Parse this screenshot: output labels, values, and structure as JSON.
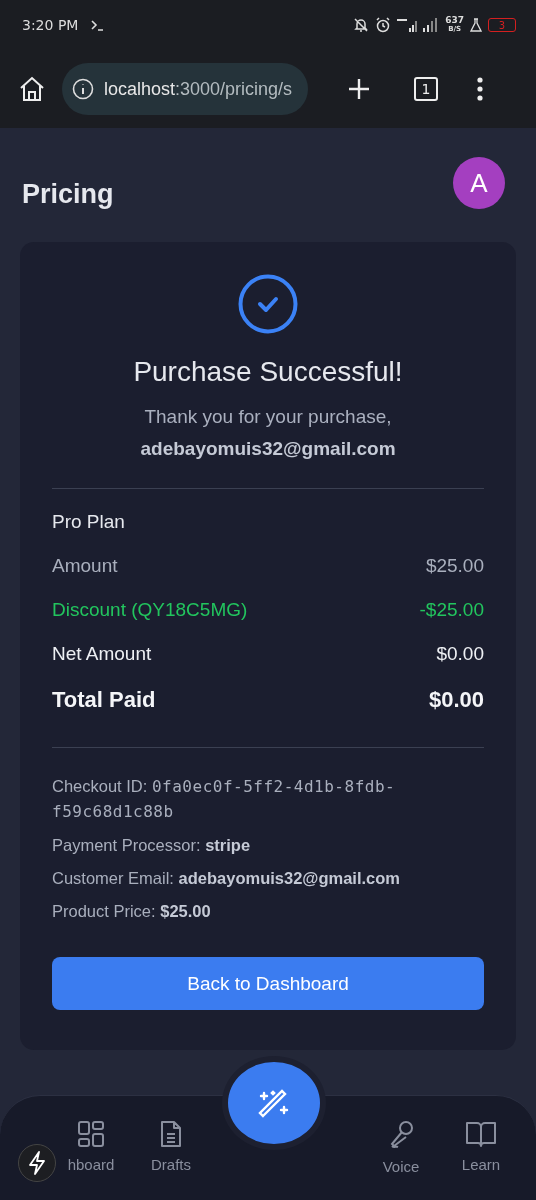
{
  "status_bar": {
    "time": "3:20 PM",
    "net_speed": "637",
    "net_unit": "B/S",
    "battery": "3"
  },
  "browser": {
    "url_host": "localhost",
    "url_rest": ":3000/pricing/s",
    "tab_count": "1"
  },
  "page": {
    "title": "Pricing",
    "avatar": "A"
  },
  "receipt": {
    "title": "Purchase Successful!",
    "message": "Thank you for your purchase,",
    "email": "adebayomuis32@gmail.com",
    "plan": "Pro Plan",
    "lines": [
      {
        "label": "Amount",
        "value": "$25.00",
        "kind": "muted"
      },
      {
        "label": "Discount (QY18C5MG)",
        "value": "-$25.00",
        "kind": "discount"
      },
      {
        "label": "Net Amount",
        "value": "$0.00",
        "kind": "strong"
      },
      {
        "label": "Total Paid",
        "value": "$0.00",
        "kind": "total"
      }
    ],
    "details": [
      {
        "label": "Checkout ID:",
        "value": "0fa0ec0f-5ff2-4d1b-8fdb-f59c68d1c88b",
        "kind": "mono"
      },
      {
        "label": "Payment Processor:",
        "value": "stripe",
        "kind": "bold"
      },
      {
        "label": "Customer Email:",
        "value": "adebayomuis32@gmail.com",
        "kind": "bold"
      },
      {
        "label": "Product Price:",
        "value": "$25.00",
        "kind": "bold"
      }
    ],
    "button": "Back to Dashboard"
  },
  "bottom_nav": [
    {
      "label": "hboard"
    },
    {
      "label": "Drafts"
    },
    {
      "label": "Voice"
    },
    {
      "label": "Learn"
    }
  ]
}
